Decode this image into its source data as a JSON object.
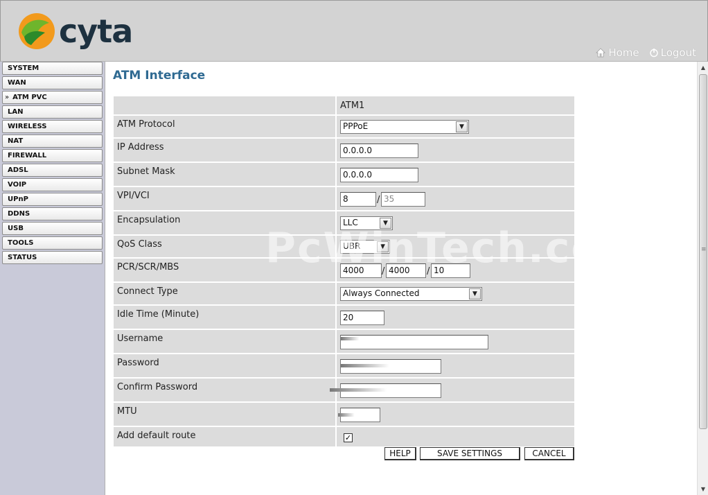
{
  "header": {
    "logo_text": "cyta",
    "home_label": "Home",
    "logout_label": "Logout"
  },
  "sidebar": {
    "items": [
      {
        "label": "SYSTEM"
      },
      {
        "label": "WAN"
      },
      {
        "label": "ATM PVC",
        "marker": "»",
        "active": true
      },
      {
        "label": "LAN"
      },
      {
        "label": "WIRELESS"
      },
      {
        "label": "NAT"
      },
      {
        "label": "FIREWALL"
      },
      {
        "label": "ADSL"
      },
      {
        "label": "VOIP"
      },
      {
        "label": "UPnP"
      },
      {
        "label": "DDNS"
      },
      {
        "label": "USB"
      },
      {
        "label": "TOOLS"
      },
      {
        "label": "STATUS"
      }
    ]
  },
  "main": {
    "title": "ATM Interface",
    "column_header": "ATM1",
    "fields": {
      "atm_protocol": {
        "label": "ATM Protocol",
        "value": "PPPoE"
      },
      "ip_address": {
        "label": "IP Address",
        "value": "0.0.0.0"
      },
      "subnet_mask": {
        "label": "Subnet Mask",
        "value": "0.0.0.0"
      },
      "vpi_vci": {
        "label": "VPI/VCI",
        "vpi": "8",
        "vci": "35",
        "separator": "/"
      },
      "encapsulation": {
        "label": "Encapsulation",
        "value": "LLC"
      },
      "qos_class": {
        "label": "QoS Class",
        "value": "UBR"
      },
      "pcr_scr_mbs": {
        "label": "PCR/SCR/MBS",
        "pcr": "4000",
        "scr": "4000",
        "mbs": "10",
        "separator": "/"
      },
      "connect_type": {
        "label": "Connect Type",
        "value": "Always Connected"
      },
      "idle_time": {
        "label": "Idle Time (Minute)",
        "value": "20"
      },
      "username": {
        "label": "Username",
        "value": ""
      },
      "password": {
        "label": "Password",
        "value": ""
      },
      "confirm_password": {
        "label": "Confirm Password",
        "value": ""
      },
      "mtu": {
        "label": "MTU",
        "value": ""
      },
      "default_route": {
        "label": "Add default route",
        "checked": true,
        "check_glyph": "✓"
      }
    },
    "buttons": {
      "help": "HELP",
      "save": "SAVE SETTINGS",
      "cancel": "CANCEL"
    },
    "watermark": "PcWinTech.com"
  },
  "icons": {
    "home": "home-icon",
    "logout": "power-icon",
    "dropdown": "chevron-down-icon"
  },
  "colors": {
    "title": "#2f6a92",
    "sidebar_bg": "#c9cad9",
    "header_bg": "#d3d3d3",
    "row_bg": "#dcdcdc",
    "logo_text": "#1d3140"
  }
}
